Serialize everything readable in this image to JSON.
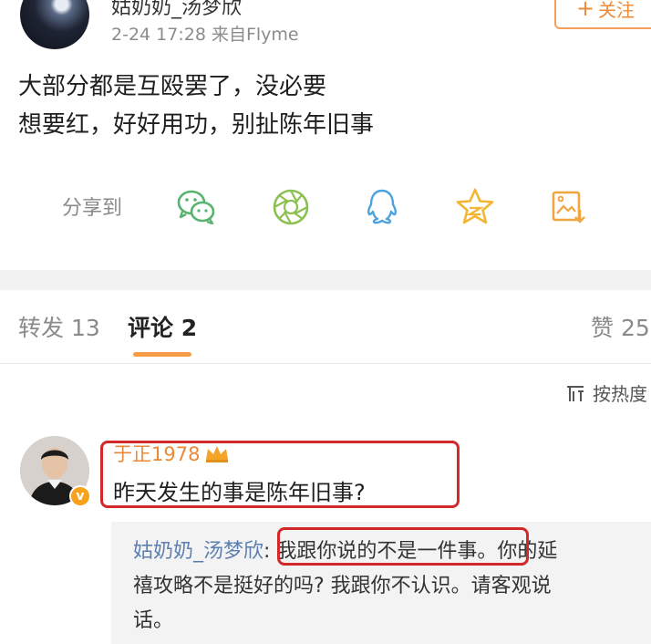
{
  "post": {
    "author_name": "姑奶奶_汤梦欣",
    "meta": "2-24 17:28  来自Flyme",
    "follow_label": "关注",
    "body_lines": [
      "大部分都是互殴罢了，没必要",
      "想要红，好好用功，别扯陈年旧事"
    ]
  },
  "share": {
    "label": "分享到",
    "icons": [
      "wechat-icon",
      "moments-icon",
      "qq-icon",
      "qzone-icon",
      "image-save-icon"
    ]
  },
  "tabs": {
    "repost": "转发 13",
    "comments": "评论 2",
    "like": "赞 25"
  },
  "sort": {
    "label": "按热度"
  },
  "comment": {
    "author": "于正1978",
    "text": "昨天发生的事是陈年旧事?",
    "reply": {
      "author": "姑奶奶_汤梦欣",
      "separator": ": ",
      "line1_rest": "我跟你说的不是一件事。你的延",
      "line2": "禧攻略不是挺好的吗? 我跟你不认识。请客观说",
      "line3": "话。"
    }
  },
  "colors": {
    "accent_orange": "#f79a45",
    "highlight_red": "#d22a2a",
    "link_blue": "#5d7fb0",
    "wechat_green": "#57b36f"
  }
}
